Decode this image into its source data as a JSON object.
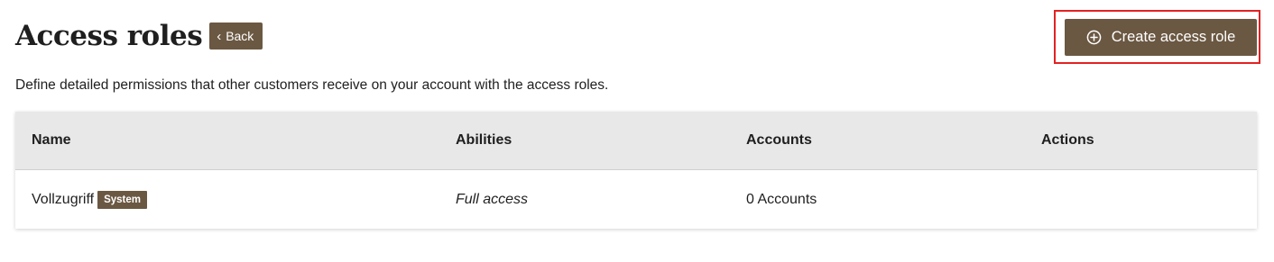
{
  "header": {
    "title": "Access roles",
    "back_label": "Back",
    "create_label": "Create access role"
  },
  "description": "Define detailed permissions that other customers receive on your account with the access roles.",
  "table": {
    "columns": [
      "Name",
      "Abilities",
      "Accounts",
      "Actions"
    ],
    "rows": [
      {
        "name": "Vollzugriff",
        "badge": "System",
        "abilities": "Full access",
        "accounts": "0 Accounts",
        "actions": ""
      }
    ]
  },
  "colors": {
    "brand": "#6b5842",
    "highlight": "#e32222",
    "table_header_bg": "#e8e8e8"
  },
  "icons": {
    "back": "chevron-left-icon",
    "create": "plus-circle-icon"
  }
}
